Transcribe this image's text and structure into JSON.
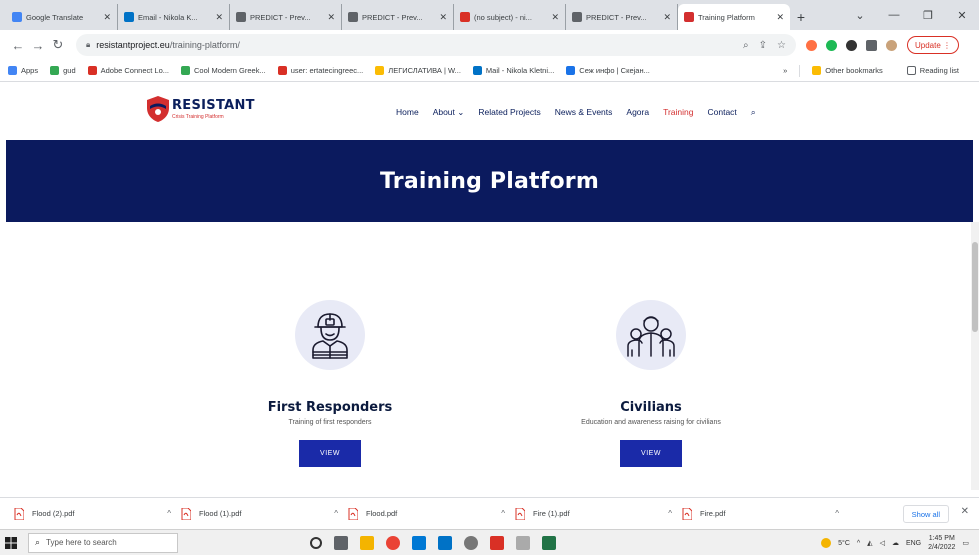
{
  "browser": {
    "tabs": [
      {
        "label": "Google Translate",
        "color": "#4285f4"
      },
      {
        "label": "Email - Nikola K...",
        "color": "#0072c6"
      },
      {
        "label": "PREDICT - Prev...",
        "color": "#5f6368"
      },
      {
        "label": "PREDICT - Prev...",
        "color": "#5f6368"
      },
      {
        "label": "(no subject) - ni...",
        "color": "#d93025"
      },
      {
        "label": "PREDICT - Prev...",
        "color": "#5f6368"
      },
      {
        "label": "Training Platform",
        "color": "#d32f2f",
        "active": true
      }
    ],
    "new_tab": "+",
    "url_host": "resistantproject.eu",
    "url_path": "/training-platform/",
    "update_label": "Update",
    "bookmarks": [
      {
        "label": "Apps",
        "color": "#4285f4"
      },
      {
        "label": "gud",
        "color": "#34a853"
      },
      {
        "label": "Adobe Connect Lo...",
        "color": "#d93025"
      },
      {
        "label": "Cool Modern Greek...",
        "color": "#34a853"
      },
      {
        "label": "user: ertatecingreec...",
        "color": "#d93025"
      },
      {
        "label": "ЛЕГИСЛАТИВА | W...",
        "color": "#fbbc04"
      },
      {
        "label": "Mail - Nikola Kletni...",
        "color": "#0072c6"
      },
      {
        "label": "Сеж инфо | Скејан...",
        "color": "#1a73e8"
      }
    ],
    "other_bookmarks": "Other bookmarks",
    "reading_list": "Reading list"
  },
  "site": {
    "logo_title": "RESISTANT",
    "logo_sub": "Crisis Training Platform",
    "nav": [
      {
        "label": "Home"
      },
      {
        "label": "About ⌄"
      },
      {
        "label": "Related Projects"
      },
      {
        "label": "News & Events"
      },
      {
        "label": "Agora"
      },
      {
        "label": "Training",
        "active": true
      },
      {
        "label": "Contact"
      }
    ],
    "hero_title": "Training Platform",
    "cards": [
      {
        "title": "First Responders",
        "desc": "Training of first responders",
        "button": "VIEW",
        "icon": "firefighter-icon"
      },
      {
        "title": "Civilians",
        "desc": "Education and awareness raising for civilians",
        "button": "VIEW",
        "icon": "people-group-icon"
      }
    ]
  },
  "downloads": {
    "items": [
      "Flood (2).pdf",
      "Flood (1).pdf",
      "Flood.pdf",
      "Fire (1).pdf",
      "Fire.pdf"
    ],
    "show_all": "Show all"
  },
  "taskbar": {
    "search_placeholder": "Type here to search",
    "temperature": "5°C",
    "language": "ENG",
    "time": "1:45 PM",
    "date": "2/4/2022"
  },
  "colors": {
    "hero_bg": "#0b1a5e",
    "accent_red": "#d32f2f",
    "button_blue": "#1a2aa8"
  }
}
